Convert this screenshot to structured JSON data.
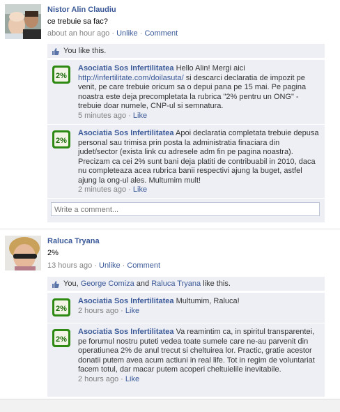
{
  "posts": [
    {
      "author": "Nistor Alin Claudiu",
      "text": "ce trebuie sa fac?",
      "time": "about an hour ago",
      "unlike": "Unlike",
      "comment": "Comment",
      "likes_text": "You like this.",
      "comments": [
        {
          "author": "Asociatia Sos Infertilitatea",
          "text_pre": " Hello Alin! Mergi aici ",
          "link": "http://infertilitate.com/doilasuta/",
          "text_post": " si descarci declaratia de impozit pe venit, pe care trebuie oricum sa o depui pana pe 15 mai. Pe pagina noastra este deja precompletata la rubrica \"2% pentru un ONG\" - trebuie doar numele, CNP-ul si semnatura.",
          "time": "5 minutes ago",
          "like": "Like"
        },
        {
          "author": "Asociatia Sos Infertilitatea",
          "text": " Apoi declaratia completata trebuie depusa personal sau trimisa prin posta la administratia finaciara din judet/sector (exista link cu adresele adm fin pe pagina noastra). Precizam ca cei 2% sunt bani deja platiti de contribuabil in 2010, daca nu completeaza acea rubrica banii respectivi ajung la buget, astfel ajung la ong-ul ales. Multumim mult!",
          "time": "2 minutes ago",
          "like": "Like"
        }
      ],
      "write_placeholder": "Write a comment..."
    },
    {
      "author": "Raluca Tryana",
      "text": "2%",
      "time": "13 hours ago",
      "unlike": "Unlike",
      "comment": "Comment",
      "likes_pre": "You, ",
      "likes_name1": "George Comiza",
      "likes_mid": " and ",
      "likes_name2": "Raluca Tryana",
      "likes_post": " like this.",
      "comments": [
        {
          "author": "Asociatia Sos Infertilitatea",
          "text": " Multumim, Raluca!",
          "time": "2 hours ago",
          "like": "Like"
        },
        {
          "author": "Asociatia Sos Infertilitatea",
          "text": " Va reamintim ca, in spiritul transparentei, pe forumul nostru puteti vedea toate sumele care ne-au parvenit din operatiunea 2% de anul trecut si cheltuirea lor. Practic, gratie acestor donatii putem avea acum actiuni in real life. Tot in regim de voluntariat facem totul, dar macar putem acoperi cheltuielile inevitabile.",
          "time": "2 hours ago",
          "like": "Like"
        }
      ]
    }
  ],
  "sep": " · ",
  "logo_text": "2%",
  "colors": {
    "link": "#3b5998",
    "comment_bg": "#edeff4",
    "meta": "#808080",
    "logo_green": "#3a9a1e"
  }
}
